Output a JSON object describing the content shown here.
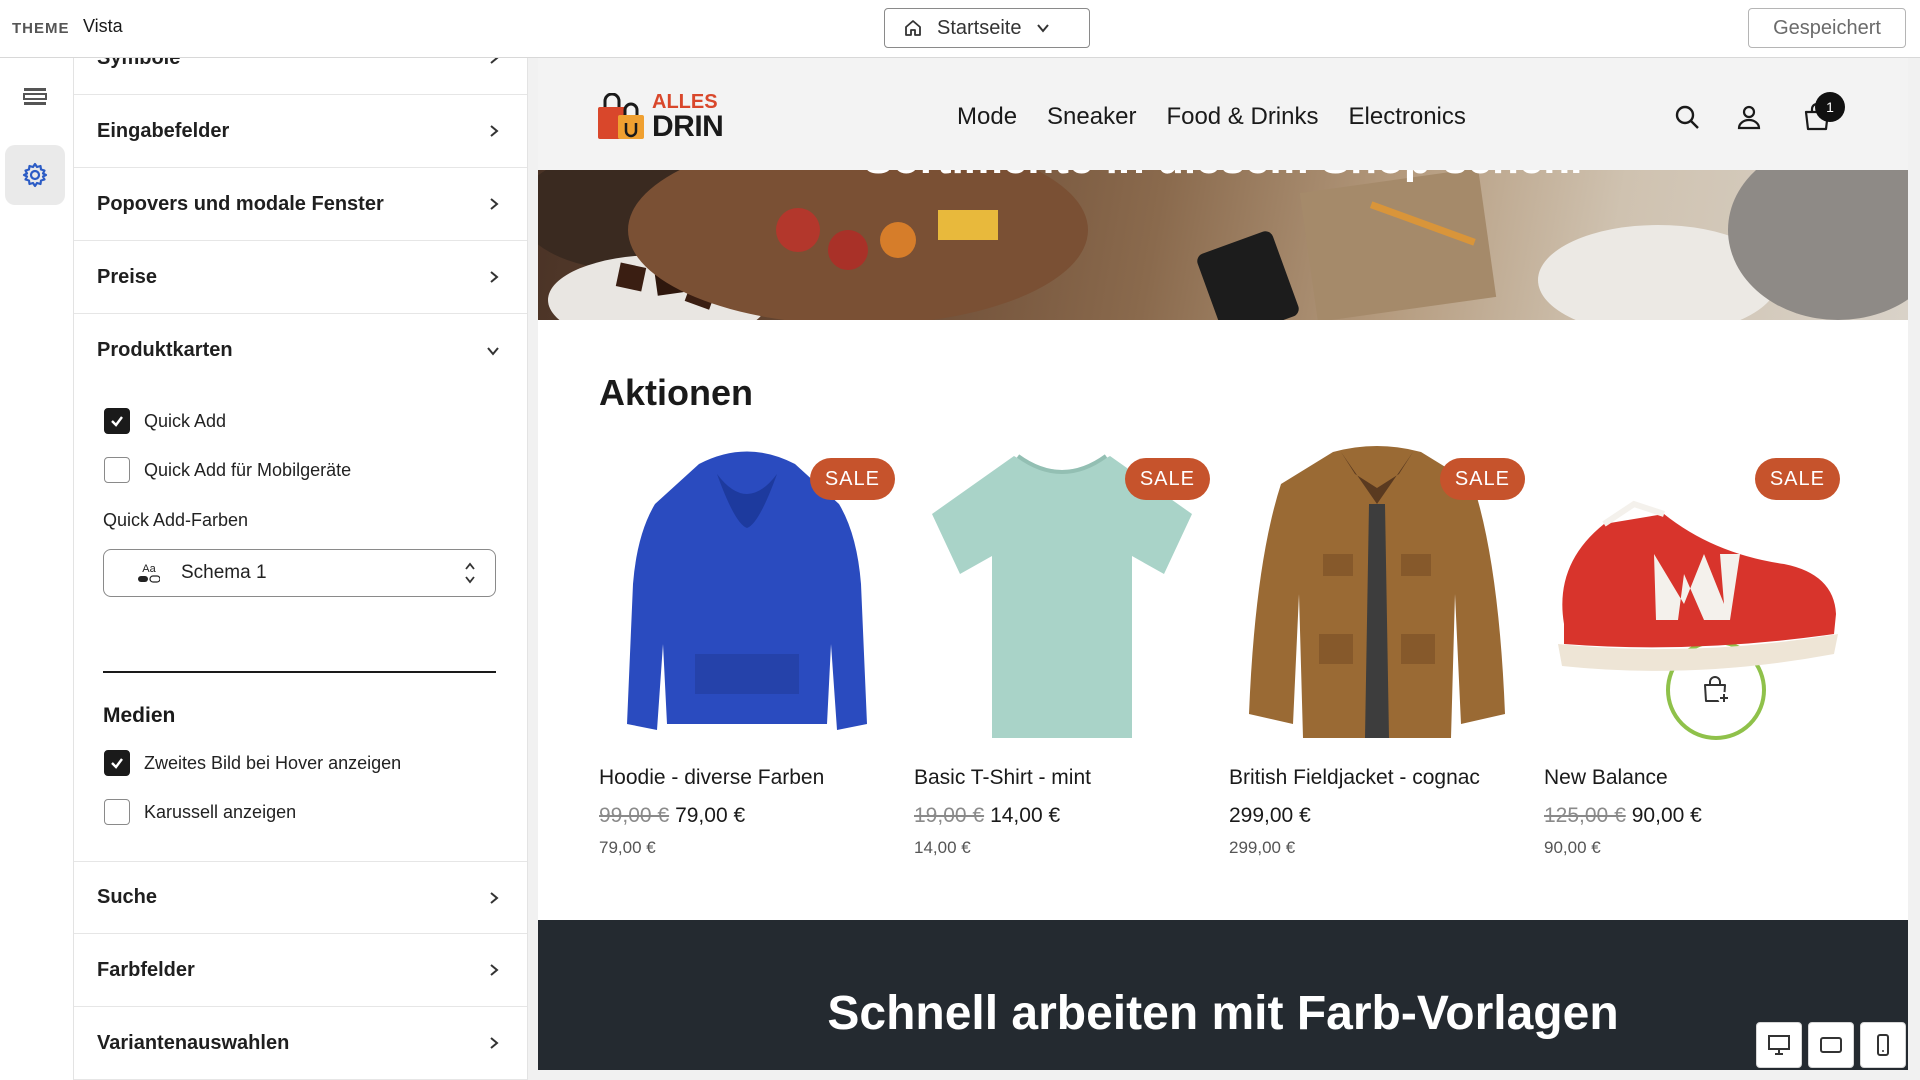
{
  "topbar": {
    "theme_label": "THEME",
    "theme_name": "Vista",
    "page_selector": "Startseite",
    "saved_label": "Gespeichert"
  },
  "rail": {
    "items": [
      {
        "icon": "sections-icon",
        "active": false
      },
      {
        "icon": "gear-icon",
        "active": true
      }
    ]
  },
  "panel": {
    "sections_top": [
      "Symbole",
      "Eingabefelder",
      "Popovers und modale Fenster",
      "Preise",
      "Produktkarten"
    ],
    "checkbox_quick_add": {
      "label": "Quick Add",
      "checked": true
    },
    "checkbox_quick_add_mobile": {
      "label": "Quick Add für Mobilgeräte",
      "checked": false
    },
    "color_field_label": "Quick Add-Farben",
    "color_field_value": "Schema 1",
    "color_field_icon_text": "Aa",
    "media_title": "Medien",
    "checkbox_hover": {
      "label": "Zweites Bild bei Hover anzeigen",
      "checked": true
    },
    "checkbox_carousel": {
      "label": "Karussell anzeigen",
      "checked": false
    },
    "sections_bottom": [
      "Suche",
      "Farbfelder",
      "Variantenauswahlen"
    ]
  },
  "shop": {
    "logo_top": "ALLES",
    "logo_bottom": "DRIN",
    "nav": [
      "Mode",
      "Sneaker",
      "Food & Drinks",
      "Electronics"
    ],
    "cart_count": "1",
    "hero_text": "Sortimente in diesem Shop sehen.",
    "section_title": "Aktionen",
    "products": [
      {
        "name": "Hoodie - diverse Farben",
        "old_price": "99,00 €",
        "price": "79,00 €",
        "unit_price": "79,00 €",
        "badge": "SALE",
        "image": "hoodie-blue"
      },
      {
        "name": "Basic T-Shirt - mint",
        "old_price": "19,00 €",
        "price": "14,00 €",
        "unit_price": "14,00 €",
        "badge": "SALE",
        "image": "tshirt-mint"
      },
      {
        "name": "British Fieldjacket - cognac",
        "old_price": "",
        "price": "299,00 €",
        "unit_price": "299,00 €",
        "badge": "SALE",
        "image": "jacket-cognac"
      },
      {
        "name": "New Balance",
        "old_price": "125,00 €",
        "price": "90,00 €",
        "unit_price": "90,00 €",
        "badge": "SALE",
        "image": "sneaker-red"
      }
    ],
    "promo_title": "Schnell arbeiten mit Farb-Vorlagen"
  },
  "device_buttons": [
    "desktop-icon",
    "tablet-icon",
    "mobile-icon"
  ],
  "colors": {
    "sale_badge": "#c6532c",
    "quick_add_ring": "#8fc14a",
    "promo_bg": "#242a30",
    "logo_accent": "#d9472b"
  }
}
